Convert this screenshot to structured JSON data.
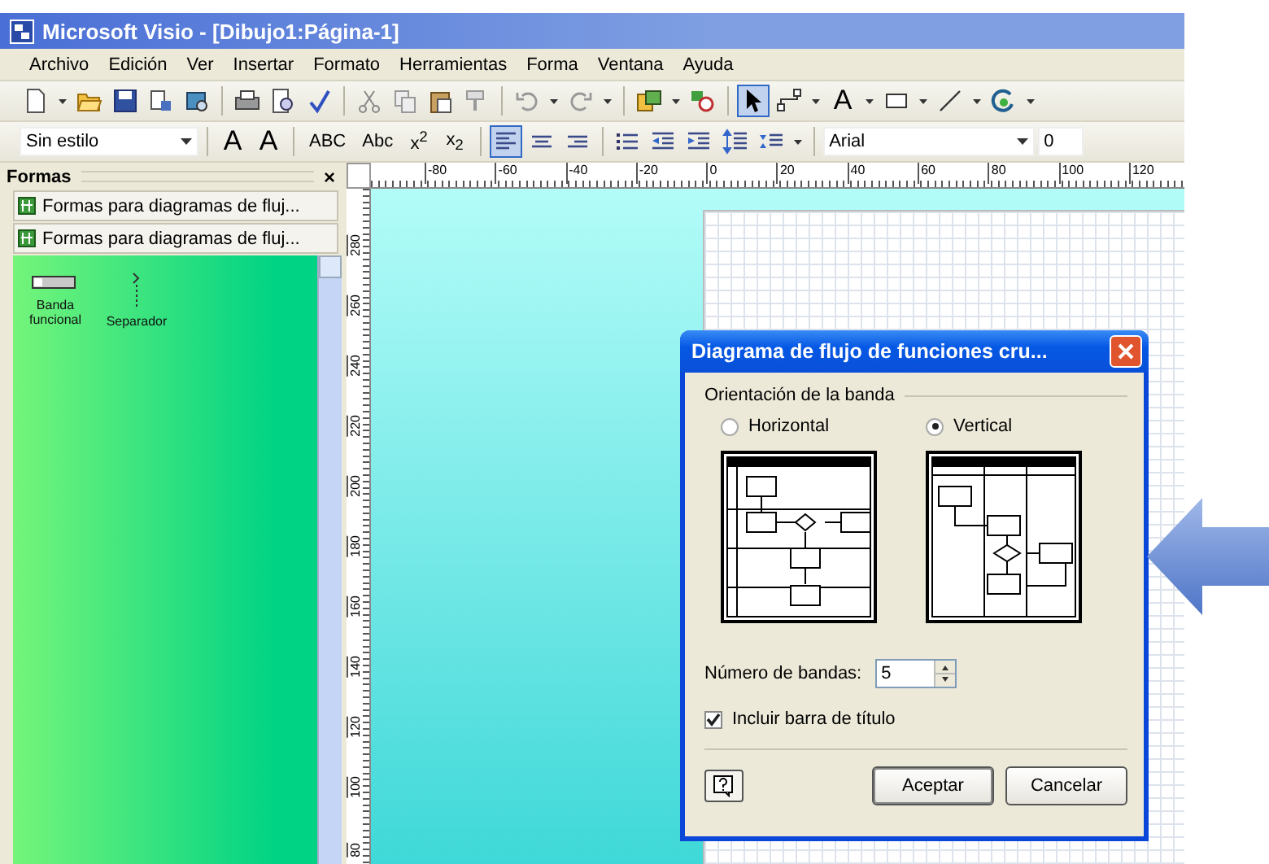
{
  "window": {
    "title": "Microsoft Visio - [Dibujo1:Página-1]"
  },
  "menu": [
    "Archivo",
    "Edición",
    "Ver",
    "Insertar",
    "Formato",
    "Herramientas",
    "Forma",
    "Ventana",
    "Ayuda"
  ],
  "standard_toolbar": [
    {
      "kind": "new",
      "selected": false
    },
    {
      "kind": "caret",
      "selected": false
    },
    {
      "kind": "open",
      "selected": false
    },
    {
      "kind": "save",
      "selected": false
    },
    {
      "kind": "permission",
      "selected": false
    },
    {
      "kind": "research",
      "selected": false
    },
    {
      "kind": "separator"
    },
    {
      "kind": "print",
      "selected": false
    },
    {
      "kind": "preview",
      "selected": false
    },
    {
      "kind": "spell",
      "selected": false
    },
    {
      "kind": "separator"
    },
    {
      "kind": "cut",
      "selected": false
    },
    {
      "kind": "copy",
      "selected": false
    },
    {
      "kind": "paste",
      "selected": false
    },
    {
      "kind": "painter",
      "selected": false
    },
    {
      "kind": "separator"
    },
    {
      "kind": "undo",
      "selected": false
    },
    {
      "kind": "caret",
      "selected": false
    },
    {
      "kind": "redo",
      "selected": false
    },
    {
      "kind": "caret",
      "selected": false
    },
    {
      "kind": "separator"
    },
    {
      "kind": "shapes",
      "selected": false
    },
    {
      "kind": "caret",
      "selected": false
    },
    {
      "kind": "panzoom",
      "selected": false
    },
    {
      "kind": "separator"
    },
    {
      "kind": "pointer",
      "selected": true
    },
    {
      "kind": "connector",
      "selected": false
    },
    {
      "kind": "caret",
      "selected": false
    },
    {
      "kind": "glyph",
      "label": "A",
      "selected": false
    },
    {
      "kind": "caret",
      "selected": false
    },
    {
      "kind": "rectangle",
      "selected": false
    },
    {
      "kind": "caret",
      "selected": false
    },
    {
      "kind": "line",
      "selected": false
    },
    {
      "kind": "caret",
      "selected": false
    },
    {
      "kind": "rotate",
      "selected": false
    },
    {
      "kind": "caret",
      "selected": false
    }
  ],
  "format_toolbar": [
    {
      "kind": "combo",
      "value": "Sin estilo"
    },
    {
      "kind": "separator"
    },
    {
      "kind": "glyph",
      "label": "A",
      "selected": false
    },
    {
      "kind": "glyph",
      "label": "A",
      "selected": false
    },
    {
      "kind": "separator"
    },
    {
      "kind": "glyph",
      "label": "ABC",
      "selected": false
    },
    {
      "kind": "glyph",
      "label": "Abc",
      "selected": false
    },
    {
      "kind": "glyph",
      "label": "x$^{2}$",
      "selected": false
    },
    {
      "kind": "glyph",
      "label": "x$_{2}$",
      "selected": false
    },
    {
      "kind": "separator"
    },
    {
      "kind": "align-left",
      "selected": true
    },
    {
      "kind": "align-center",
      "selected": false
    },
    {
      "kind": "align-right",
      "selected": false
    },
    {
      "kind": "separator"
    },
    {
      "kind": "bullets",
      "selected": false
    },
    {
      "kind": "outdent",
      "selected": false
    },
    {
      "kind": "indent",
      "selected": false
    },
    {
      "kind": "spacing-more",
      "selected": false
    },
    {
      "kind": "spacing-less",
      "selected": false
    },
    {
      "kind": "caret",
      "selected": false
    },
    {
      "kind": "separator"
    },
    {
      "kind": "font",
      "value": "Arial"
    },
    {
      "kind": "size",
      "value": "0"
    }
  ],
  "shapes_panel": {
    "title": "Formas",
    "close": "×",
    "stencils": [
      {
        "label": "Formas para diagramas de fluj..."
      },
      {
        "label": "Formas para diagramas de fluj..."
      }
    ],
    "shapes": [
      {
        "kind": "band",
        "label": "Banda funcional"
      },
      {
        "kind": "separator",
        "label": "Separador"
      }
    ]
  },
  "rulers": {
    "horizontal": [
      "-80",
      "-60",
      "-40",
      "-20",
      "0",
      "20",
      "40",
      "60",
      "80",
      "100",
      "120"
    ],
    "vertical": [
      "280",
      "260",
      "240",
      "220",
      "200",
      "180",
      "160",
      "140",
      "120",
      "100",
      "80"
    ]
  },
  "dialog": {
    "title": "Diagrama de flujo de funciones cru...",
    "group_label": "Orientación de la banda",
    "orientations": [
      {
        "label": "Horizontal",
        "kind": "horizontal",
        "selected": false
      },
      {
        "label": "Vertical",
        "kind": "vertical",
        "selected": true
      }
    ],
    "band_count_label": "Número de bandas:",
    "band_count": "5",
    "title_bar_option": {
      "label": "Incluir barra de título",
      "checked": true
    },
    "buttons": [
      {
        "label": "Aceptar",
        "default": true
      },
      {
        "label": "Cancelar",
        "default": false
      }
    ]
  }
}
